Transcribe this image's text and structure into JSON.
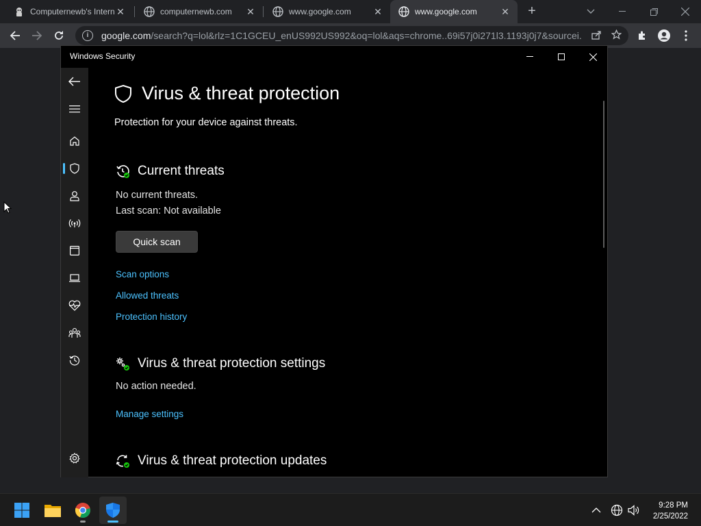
{
  "browser": {
    "tabs": [
      {
        "title": "Computernewb's Intern",
        "favicon": "computernewb-icon"
      },
      {
        "title": "computernewb.com",
        "favicon": "globe-icon"
      },
      {
        "title": "www.google.com",
        "favicon": "globe-icon"
      },
      {
        "title": "www.google.com",
        "favicon": "globe-icon",
        "active": true
      }
    ],
    "url_host": "google.com",
    "url_rest": "/search?q=lol&rlz=1C1GCEU_enUS992US992&oq=lol&aqs=chrome..69i57j0i271l3.1193j0j7&sourcei..."
  },
  "security": {
    "window_title": "Windows Security",
    "page_title": "Virus & threat protection",
    "subtitle": "Protection for your device against threats.",
    "current_threats": {
      "heading": "Current threats",
      "status": "No current threats.",
      "last_scan": "Last scan: Not available",
      "quick_scan": "Quick scan",
      "links": [
        "Scan options",
        "Allowed threats",
        "Protection history"
      ]
    },
    "settings": {
      "heading": "Virus & threat protection settings",
      "status": "No action needed.",
      "link": "Manage settings"
    },
    "updates": {
      "heading": "Virus & threat protection updates"
    },
    "nav_icons": [
      "back-icon",
      "menu-icon",
      "home-icon",
      "shield-icon",
      "account-icon",
      "network-icon",
      "app-browser-icon",
      "device-icon",
      "health-icon",
      "family-icon",
      "history-icon",
      "settings-icon"
    ]
  },
  "taskbar": {
    "apps": [
      "start-icon",
      "file-explorer-icon",
      "chrome-icon",
      "windows-security-icon"
    ],
    "time": "9:28 PM",
    "date": "2/25/2022"
  },
  "colors": {
    "accent": "#4cc2ff",
    "window_bg": "#000000",
    "nav_bg": "#1f1f1f",
    "chrome_bg": "#202124",
    "chrome_toolbar": "#35363a"
  }
}
